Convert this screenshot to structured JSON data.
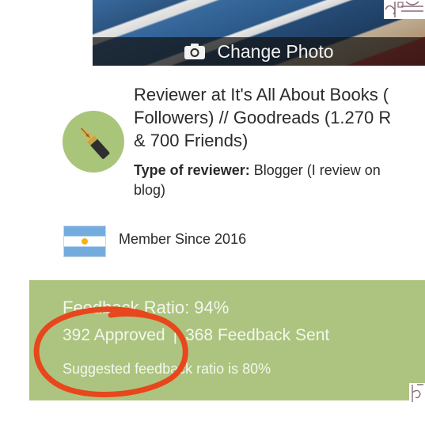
{
  "header": {
    "change_photo_label": "Change Photo",
    "camera_icon": "camera-icon"
  },
  "profile": {
    "reviewer_line1": "Reviewer at It's All About Books (",
    "reviewer_line2": "Followers) // Goodreads (1.270 R",
    "reviewer_line3": "& 700 Friends)",
    "type_label": "Type of reviewer:",
    "type_value_line1": "Blogger (I review on",
    "type_value_line2": "blog)",
    "avatar_icon": "fountain-pen-icon",
    "flag_icon": "argentina-flag-icon",
    "member_since": "Member Since 2016"
  },
  "feedback": {
    "ratio": "Feedback Ratio: 94%",
    "approved": "392 Approved",
    "separator": "|",
    "sent": "368 Feedback Sent",
    "suggested": "Suggested feedback ratio is 80%"
  },
  "colors": {
    "panel": "#acc47f",
    "annotation": "#e8461c",
    "avatar": "#a8c57a"
  }
}
